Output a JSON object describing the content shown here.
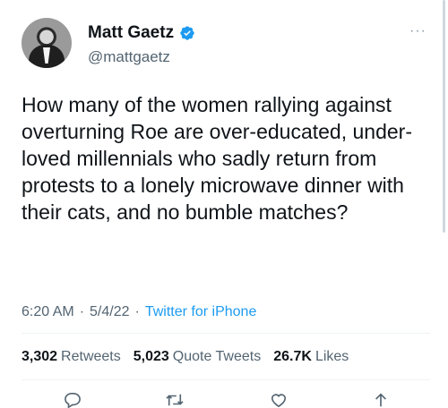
{
  "tweet": {
    "author": {
      "name": "Matt Gaetz",
      "handle": "@mattgaetz",
      "more_label": "···"
    },
    "text": "How many of the women rallying against overturning Roe are over-educated, under-loved millennials who sadly return from protests to a lonely microwave dinner with their cats, and no bumble matches?",
    "time": "6:20 AM",
    "separator": "·",
    "date": "5/4/22",
    "source": "Twitter for iPhone",
    "stats": {
      "retweets_count": "3,302",
      "retweets_label": "Retweets",
      "quotes_count": "5,023",
      "quotes_label": "Quote Tweets",
      "likes_count": "26.7K",
      "likes_label": "Likes"
    }
  },
  "icons": {
    "verified": "verified-badge-icon",
    "reply": "reply-icon",
    "retweet": "retweet-icon",
    "like": "heart-icon",
    "share": "share-icon"
  },
  "colors": {
    "accent": "#1d9bf0",
    "text_primary": "#0f1419",
    "text_secondary": "#536471",
    "divider": "#eff3f4"
  }
}
